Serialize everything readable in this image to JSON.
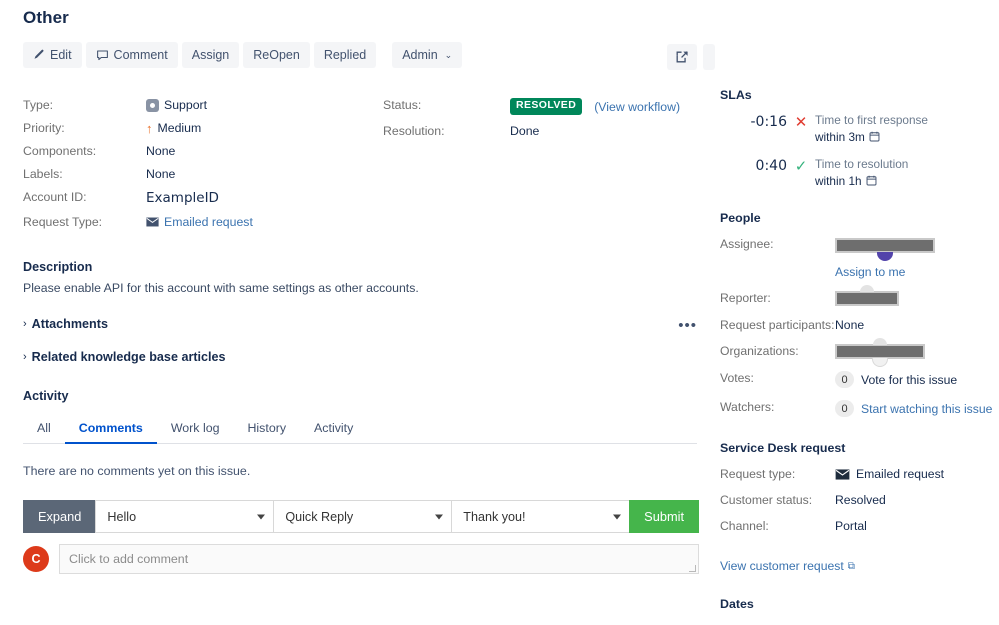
{
  "page": {
    "title": "Other"
  },
  "toolbar": {
    "buttons": [
      {
        "label": "Edit",
        "icon": "pencil-icon"
      },
      {
        "label": "Comment",
        "icon": "speech-bubble-icon"
      },
      {
        "label": "Assign",
        "icon": ""
      },
      {
        "label": "ReOpen",
        "icon": ""
      },
      {
        "label": "Replied",
        "icon": ""
      }
    ],
    "admin": {
      "label": "Admin",
      "caret": "⌄"
    }
  },
  "top_right": {
    "export_icon": "share-export-icon"
  },
  "details": {
    "left": [
      {
        "label": "Type:",
        "value": "Support",
        "icon": "support-type-icon"
      },
      {
        "label": "Priority:",
        "value": "Medium",
        "icon": "priority-medium-arrow-icon"
      },
      {
        "label": "Components:",
        "value": "None",
        "icon": ""
      },
      {
        "label": "Labels:",
        "value": "None",
        "icon": ""
      },
      {
        "label": "Account ID:",
        "value": "ExampleID",
        "icon": ""
      },
      {
        "label": "Request Type:",
        "value": "Emailed request",
        "icon": "envelope-icon"
      }
    ],
    "right": [
      {
        "label": "Status:",
        "value": "RESOLVED",
        "link": "(View workflow)"
      },
      {
        "label": "Resolution:",
        "value": "Done",
        "link": ""
      }
    ]
  },
  "description": {
    "heading": "Description",
    "body": "Please enable API for this account with same settings as other accounts."
  },
  "attachments": {
    "heading": "Attachments",
    "chevron": "›",
    "more": "•••"
  },
  "kb_articles": {
    "heading": "Related knowledge base articles",
    "chevron": "›"
  },
  "activity": {
    "heading": "Activity",
    "tabs": [
      {
        "label": "All",
        "selected": false
      },
      {
        "label": "Comments",
        "selected": true
      },
      {
        "label": "Work log",
        "selected": false
      },
      {
        "label": "History",
        "selected": false
      },
      {
        "label": "Activity",
        "selected": false
      }
    ],
    "empty_text": "There are no comments yet on this issue."
  },
  "comment_bar": {
    "expand_label": "Expand",
    "select_1": "Hello",
    "select_2": "Quick Reply",
    "select_3": "Thank you!",
    "submit_label": "Submit",
    "avatar_initial": "C",
    "input_placeholder": "Click to add comment",
    "input_value": ""
  },
  "slas": {
    "heading": "SLAs",
    "items": [
      {
        "time": "-0:16",
        "state": "breached",
        "mark": "✕",
        "goal": "Time to first response",
        "within": "within 3m",
        "calendar_icon": "calendar-icon"
      },
      {
        "time": "0:40",
        "state": "met",
        "mark": "✓",
        "goal": "Time to resolution",
        "within": "within 1h",
        "calendar_icon": "calendar-icon"
      }
    ]
  },
  "people": {
    "heading": "People",
    "assignee_label": "Assignee:",
    "assignee_value": "",
    "assign_to_me": "Assign to me",
    "reporter_label": "Reporter:",
    "reporter_value": "",
    "participants_label": "Request participants:",
    "participants_value": "None",
    "organizations_label": "Organizations:",
    "organizations_value": "",
    "votes_label": "Votes:",
    "votes_count": "0",
    "votes_link": "Vote for this issue",
    "watchers_label": "Watchers:",
    "watchers_count": "0",
    "watchers_link": "Start watching this issue"
  },
  "service_desk": {
    "heading": "Service Desk request",
    "request_type_label": "Request type:",
    "request_type_value": "Emailed request",
    "customer_status_label": "Customer status:",
    "customer_status_value": "Resolved",
    "channel_label": "Channel:",
    "channel_value": "Portal",
    "view_request_link": "View customer request",
    "external_glyph": "⧉"
  },
  "dates": {
    "heading": "Dates"
  },
  "colors": {
    "accent_link": "#3b73af",
    "status_green": "#00875a",
    "submit_green": "#45b54b",
    "expand_gray": "#5b6777",
    "priority_orange": "#e9702a",
    "tab_blue": "#0052cc",
    "avatar_red": "#dd3a1a",
    "sla_breach_red": "#e03c31",
    "sla_ok_green": "#36b37e"
  }
}
